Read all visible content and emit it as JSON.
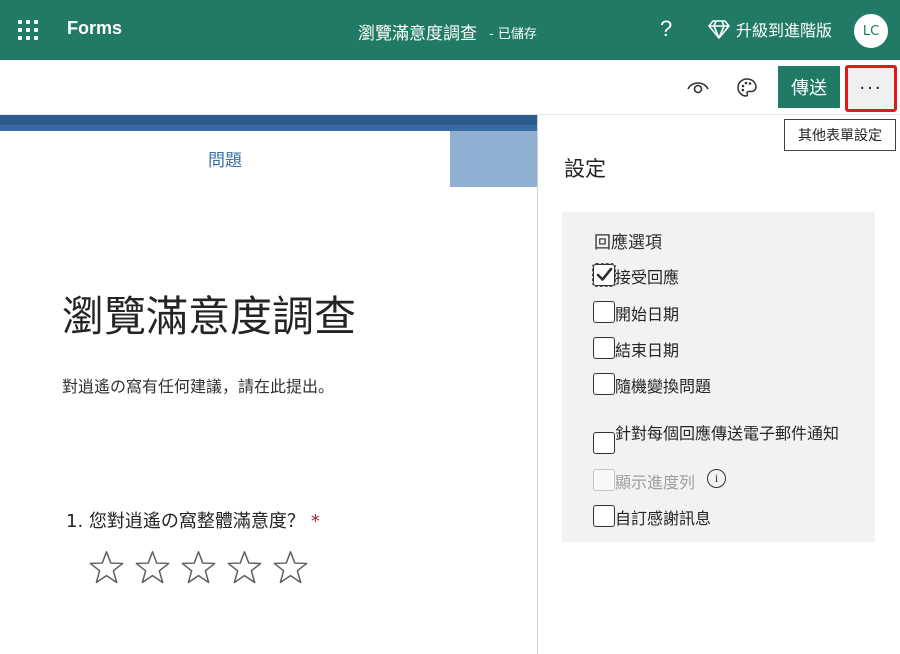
{
  "header": {
    "app_name": "Forms",
    "doc_title": "瀏覽滿意度調查",
    "doc_status": "- 已儲存",
    "help": "?",
    "upgrade_label": "升級到進階版",
    "avatar_initials": "LC",
    "bg_color": "#217a65"
  },
  "toolbar": {
    "send_label": "傳送",
    "more_label": "···",
    "tooltip": "其他表單設定"
  },
  "tabs": {
    "question_label": "問題"
  },
  "form": {
    "title": "瀏覽滿意度調查",
    "description": "對逍遙の窩有任何建議，請在此提出。",
    "questions": [
      {
        "label": "1. 您對逍遙の窩整體滿意度？",
        "required_mark": "*",
        "rating_stars": 5
      }
    ]
  },
  "settings": {
    "title": "設定",
    "section_title": "回應選項",
    "options": [
      {
        "label": "接受回應",
        "checked": true,
        "disabled": false
      },
      {
        "label": "開始日期",
        "checked": false,
        "disabled": false
      },
      {
        "label": "結束日期",
        "checked": false,
        "disabled": false
      },
      {
        "label": "隨機變換問題",
        "checked": false,
        "disabled": false
      },
      {
        "label": "針對每個回應傳送電子郵件通知",
        "checked": false,
        "disabled": false
      },
      {
        "label": "顯示進度列",
        "checked": false,
        "disabled": true
      },
      {
        "label": "自訂感謝訊息",
        "checked": false,
        "disabled": false
      }
    ]
  }
}
